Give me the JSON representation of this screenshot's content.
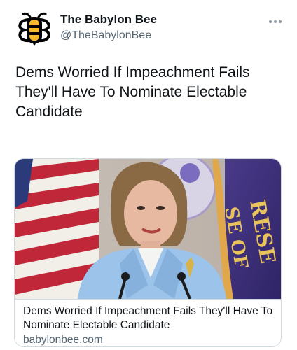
{
  "author": {
    "display_name": "The Babylon Bee",
    "handle": "@TheBabylonBee",
    "avatar_icon": "bee-logo-icon",
    "brand_color": "#f5b82e"
  },
  "tweet": {
    "text": "Dems Worried If Impeachment Fails They'll Have To Nominate Electable Candidate"
  },
  "menu": {
    "icon": "more-horizontal-icon"
  },
  "card": {
    "image_description_icon": "article-thumbnail",
    "title": "Dems Worried If Impeachment Fails They'll Have To Nominate Electable Candidate",
    "domain": "babylonbee.com"
  },
  "colors": {
    "text_primary": "#0f1419",
    "text_secondary": "#536471",
    "border": "#cfd9de"
  }
}
